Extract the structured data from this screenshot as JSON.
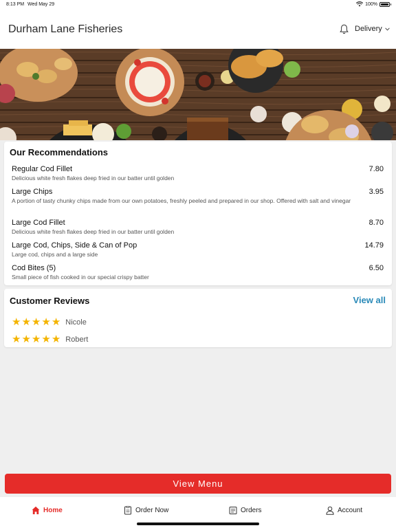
{
  "status_bar": {
    "time": "8:13 PM",
    "date": "Wed May 29",
    "battery": "100%"
  },
  "header": {
    "title": "Durham Lane Fisheries",
    "delivery_label": "Delivery"
  },
  "recommendations": {
    "title": "Our Recommendations",
    "items": [
      {
        "name": "Regular Cod Fillet",
        "price": "7.80",
        "desc": "Delicious white fresh flakes deep fried in our batter until golden"
      },
      {
        "name": "Large Chips",
        "price": "3.95",
        "desc": "A portion of tasty chunky chips made from our own potatoes, freshly peeled and prepared in our shop. Offered with salt and vinegar"
      },
      {
        "name": "Large Cod Fillet",
        "price": "8.70",
        "desc": "Delicious white fresh flakes deep fried in our batter until golden"
      },
      {
        "name": "Large Cod, Chips, Side & Can of Pop",
        "price": "14.79",
        "desc": "Large cod, chips and a large side"
      },
      {
        "name": "Cod Bites (5)",
        "price": "6.50",
        "desc": "Small piece of fish cooked in our special crispy batter"
      }
    ]
  },
  "reviews": {
    "title": "Customer Reviews",
    "view_all": "View all",
    "entries": [
      {
        "name": "Nicole",
        "rating": 5
      },
      {
        "name": "Robert",
        "rating": 5
      }
    ]
  },
  "view_menu_label": "View Menu",
  "tabs": [
    {
      "label": "Home",
      "icon": "home-icon",
      "active": true
    },
    {
      "label": "Order Now",
      "icon": "order-icon",
      "active": false
    },
    {
      "label": "Orders",
      "icon": "orders-icon",
      "active": false
    },
    {
      "label": "Account",
      "icon": "account-icon",
      "active": false
    }
  ],
  "colors": {
    "accent": "#e52c29",
    "link": "#2a8ab8",
    "star": "#f4b400"
  }
}
